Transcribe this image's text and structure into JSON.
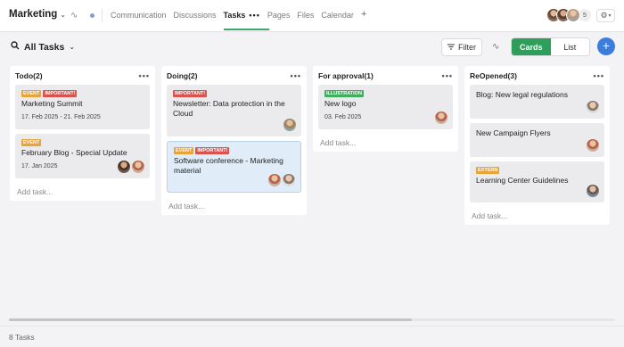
{
  "project": {
    "name": "Marketing"
  },
  "nav": {
    "tabs": [
      {
        "label": "Communication"
      },
      {
        "label": "Discussions"
      },
      {
        "label": "Tasks"
      },
      {
        "label": "Pages"
      },
      {
        "label": "Files"
      },
      {
        "label": "Calendar"
      }
    ],
    "active_tab": "Tasks",
    "more_label": "•••",
    "add_label": "+",
    "members_extra": "5"
  },
  "toolbar": {
    "view_title": "All Tasks",
    "filter_label": "Filter",
    "views": [
      "Cards",
      "List"
    ],
    "active_view": "Cards",
    "add_label": "+"
  },
  "columns": [
    {
      "title": "Todo(2)",
      "cards": [
        {
          "tags": [
            "EVENT",
            "IMPORTANT!"
          ],
          "title": "Marketing Summit",
          "date": "17. Feb 2025 - 21. Feb 2025"
        },
        {
          "tags": [
            "EVENT"
          ],
          "title": "February Blog - Special Update",
          "date": "17. Jan 2025"
        }
      ],
      "add_label": "Add task..."
    },
    {
      "title": "Doing(2)",
      "cards": [
        {
          "tags": [
            "IMPORTANT!"
          ],
          "title": "Newsletter: Data protection in the Cloud"
        },
        {
          "tags": [
            "EVENT",
            "IMPORTANT!"
          ],
          "title": "Software conference - Marketing material"
        }
      ],
      "add_label": "Add task..."
    },
    {
      "title": "For approval(1)",
      "cards": [
        {
          "tags": [
            "ILLUSTRATION"
          ],
          "title": "New logo",
          "date": "03. Feb 2025"
        }
      ],
      "add_label": "Add task..."
    },
    {
      "title": "ReOpened(3)",
      "cards": [
        {
          "title": "Blog: New legal regulations"
        },
        {
          "title": "New Campaign Flyers"
        },
        {
          "tags": [
            "EXTERN"
          ],
          "title": "Learning Center Guidelines"
        }
      ],
      "add_label": "Add task..."
    }
  ],
  "footer": {
    "count": "8 Tasks"
  },
  "colors": {
    "accent_green": "#2e9e5b",
    "accent_blue": "#3b7ddd",
    "event": "#e8a33b",
    "important": "#d9534f",
    "illustration": "#3fae5e"
  }
}
